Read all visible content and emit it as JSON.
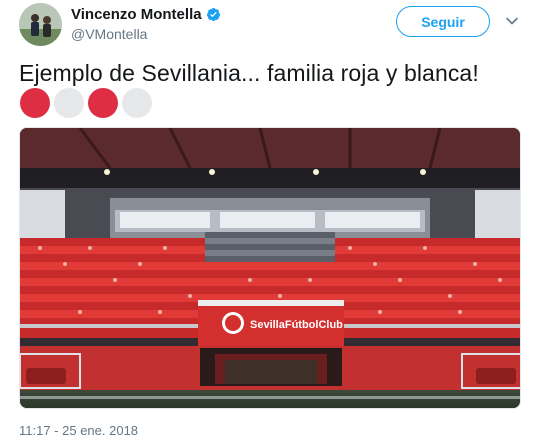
{
  "author": {
    "display_name": "Vincenzo Montella",
    "handle": "@VMontella",
    "verified": true
  },
  "follow_button": {
    "label": "Seguir"
  },
  "tweet": {
    "text": "Ejemplo de Sevillania... familia roja y blanca!",
    "emoji_circles": [
      {
        "icon": "red-circle-icon",
        "color": "#dd2e44"
      },
      {
        "icon": "white-circle-icon",
        "color": "#e6e7e8"
      },
      {
        "icon": "red-circle-icon",
        "color": "#dd2e44"
      },
      {
        "icon": "white-circle-icon",
        "color": "#e6e7e8"
      }
    ],
    "timestamp": "11:17 - 25 ene. 2018"
  },
  "photo": {
    "banner_text": "SevillaFútbolClub"
  },
  "colors": {
    "accent": "#1da1f2",
    "sevilla_red": "#d32f2f"
  }
}
